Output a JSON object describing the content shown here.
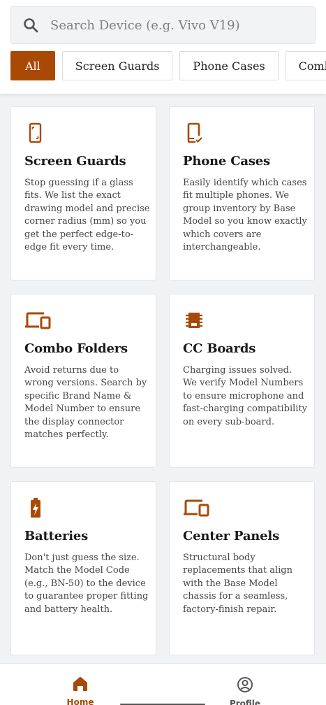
{
  "search": {
    "placeholder": "Search Device (e.g. Vivo V19)",
    "icon": "search-icon"
  },
  "filters": [
    {
      "label": "All",
      "active": true
    },
    {
      "label": "Screen Guards",
      "active": false
    },
    {
      "label": "Phone Cases",
      "active": false
    },
    {
      "label": "Combo Folders",
      "active": false
    }
  ],
  "cards": [
    {
      "title": "Screen Guards",
      "icon": "smartphone-outline-icon",
      "description": "Stop guessing if a glass fits. We list the exact drawing model and precise corner radius (mm) so you get the perfect edge-to-edge fit every time."
    },
    {
      "title": "Phone Cases",
      "icon": "phone-check-icon",
      "description": "Easily identify which cases fit multiple phones. We group inventory by Base Model so you know exactly which covers are interchangeable."
    },
    {
      "title": "Combo Folders",
      "icon": "devices-icon",
      "description": "Avoid returns due to wrong versions. Search by specific Brand Name & Model Number to ensure the display connector matches perfectly."
    },
    {
      "title": "CC Boards",
      "icon": "chip-icon",
      "description": "Charging issues solved. We verify Model Numbers to ensure microphone and fast-charging compatibility on every sub-board."
    },
    {
      "title": "Batteries",
      "icon": "battery-charging-icon",
      "description": "Don't just guess the size. Match the Model Code (e.g., BN-50) to the device to guarantee proper fitting and battery health."
    },
    {
      "title": "Center Panels",
      "icon": "devices-icon",
      "description": "Structural body replacements that align with the Base Model chassis for a seamless, factory-finish repair."
    }
  ],
  "nav": {
    "home": {
      "label": "Home",
      "icon": "home-icon",
      "active": true
    },
    "profile": {
      "label": "Profile",
      "icon": "account-circle-icon",
      "active": false
    }
  },
  "colors": {
    "accent": "#a84a06",
    "background": "#f1f2f4"
  }
}
